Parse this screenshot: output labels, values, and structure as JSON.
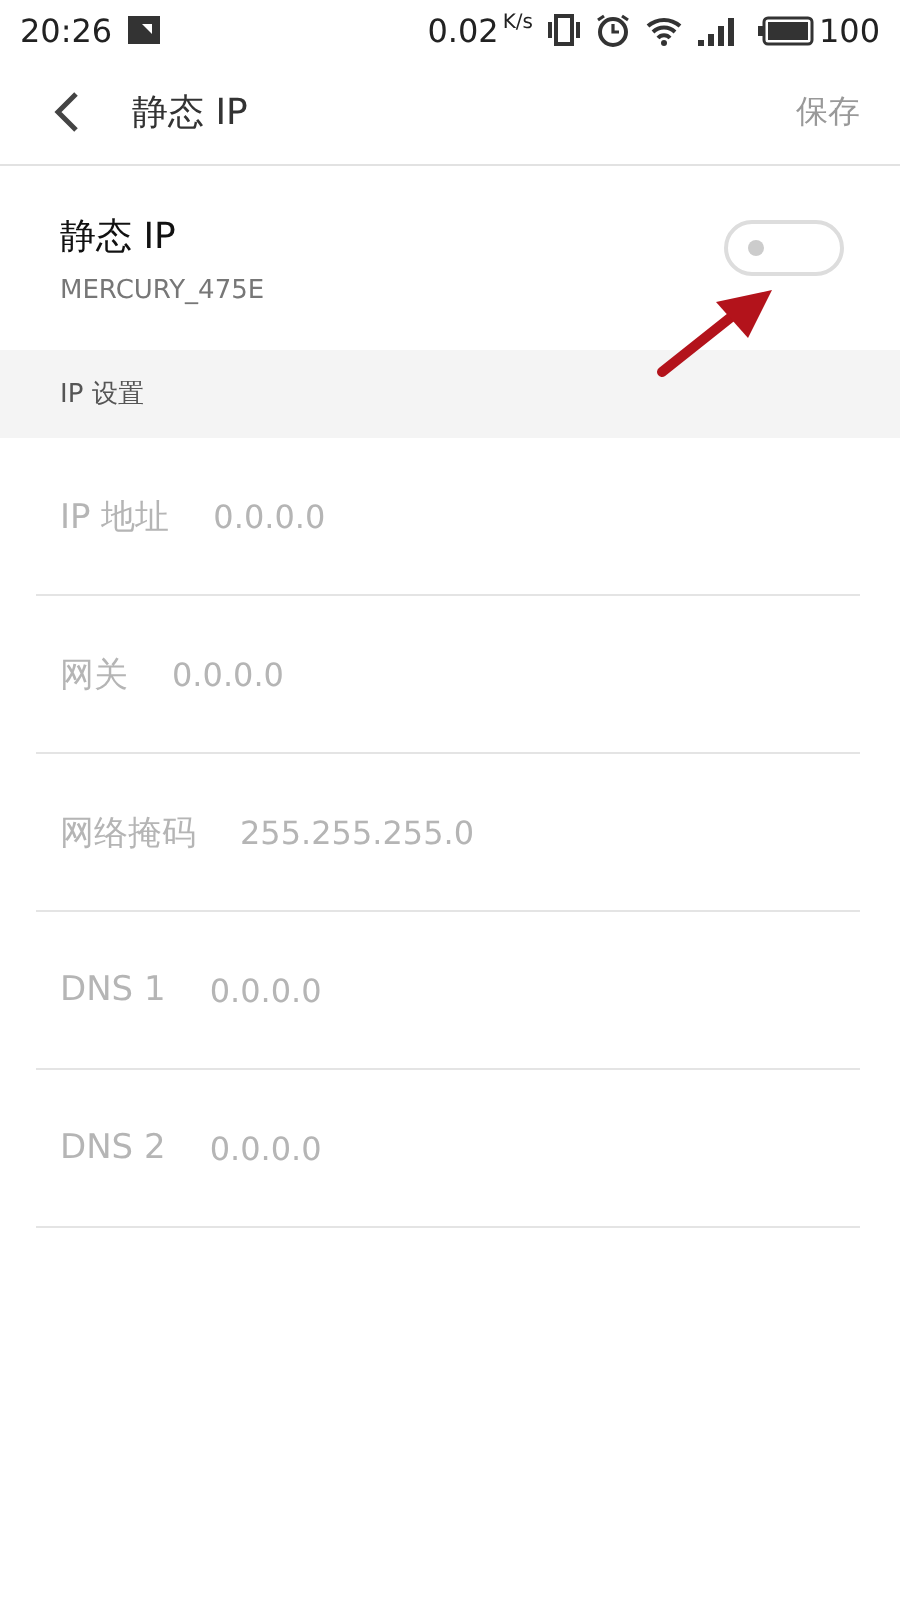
{
  "status_bar": {
    "time": "20:26",
    "speed": "0.02",
    "speed_unit": "K/s",
    "battery": "100"
  },
  "header": {
    "title": "静态 IP",
    "action": "保存"
  },
  "static_ip": {
    "title": "静态 IP",
    "network": "MERCURY_475E",
    "on": false
  },
  "section": {
    "title": "IP 设置"
  },
  "fields": [
    {
      "label": "IP 地址",
      "value": "0.0.0.0",
      "disabled": true
    },
    {
      "label": "网关",
      "value": "0.0.0.0",
      "disabled": true
    },
    {
      "label": "网络掩码",
      "value": "255.255.255.0",
      "disabled": true
    },
    {
      "label": "DNS 1",
      "value": "0.0.0.0",
      "disabled": true
    },
    {
      "label": "DNS 2",
      "value": "0.0.0.0",
      "disabled": true
    }
  ]
}
